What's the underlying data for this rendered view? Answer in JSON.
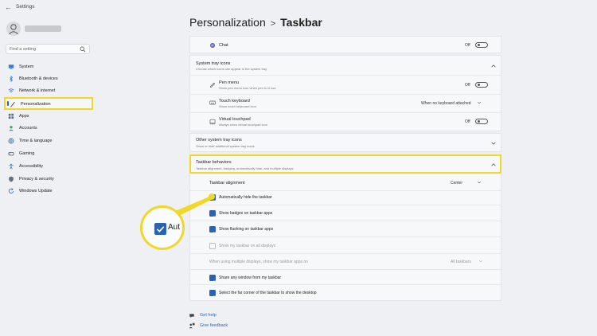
{
  "window": {
    "title": "Settings"
  },
  "sidebar": {
    "search_placeholder": "Find a setting",
    "items": [
      {
        "label": "System",
        "icon": "monitor-icon",
        "active": false
      },
      {
        "label": "Bluetooth & devices",
        "icon": "bluetooth-icon",
        "active": false
      },
      {
        "label": "Network & internet",
        "icon": "wifi-icon",
        "active": false
      },
      {
        "label": "Personalization",
        "icon": "brush-icon",
        "active": true
      },
      {
        "label": "Apps",
        "icon": "apps-icon",
        "active": false
      },
      {
        "label": "Accounts",
        "icon": "person-icon",
        "active": false
      },
      {
        "label": "Time & language",
        "icon": "globe-icon",
        "active": false
      },
      {
        "label": "Gaming",
        "icon": "gamepad-icon",
        "active": false
      },
      {
        "label": "Accessibility",
        "icon": "accessibility-icon",
        "active": false
      },
      {
        "label": "Privacy & security",
        "icon": "shield-icon",
        "active": false
      },
      {
        "label": "Windows Update",
        "icon": "update-icon",
        "active": false
      }
    ]
  },
  "breadcrumb": {
    "parent": "Personalization",
    "separator": ">",
    "current": "Taskbar"
  },
  "chat": {
    "label": "Chat",
    "state": "Off"
  },
  "system_tray": {
    "title": "System tray icons",
    "subtitle": "Choose which icons can appear in the system tray",
    "items": [
      {
        "title": "Pen menu",
        "subtitle": "Show pen menu icon when pen is in use",
        "control": "toggle",
        "state": "Off"
      },
      {
        "title": "Touch keyboard",
        "subtitle": "Show touch keyboard icon",
        "control": "dropdown",
        "value": "When no keyboard attached"
      },
      {
        "title": "Virtual touchpad",
        "subtitle": "Always show virtual touchpad icon",
        "control": "toggle",
        "state": "Off"
      }
    ]
  },
  "other_tray": {
    "title": "Other system tray icons",
    "subtitle": "Show or hide additional system tray icons"
  },
  "behaviors": {
    "title": "Taskbar behaviors",
    "subtitle": "Taskbar alignment, badging, automatically hide, and multiple displays",
    "alignment_label": "Taskbar alignment",
    "alignment_value": "Center",
    "checkboxes": [
      {
        "label": "Automatically hide the taskbar",
        "checked": true,
        "enabled": true
      },
      {
        "label": "Show badges on taskbar apps",
        "checked": true,
        "enabled": true
      },
      {
        "label": "Show flashing on taskbar apps",
        "checked": true,
        "enabled": true
      },
      {
        "label": "Show my taskbar on all displays",
        "checked": false,
        "enabled": false
      }
    ],
    "multi_display_label": "When using multiple displays, show my taskbar apps on",
    "multi_display_value": "All taskbars",
    "checkboxes2": [
      {
        "label": "Share any window from my taskbar",
        "checked": true
      },
      {
        "label": "Select the far corner of the taskbar to show the desktop",
        "checked": true
      }
    ]
  },
  "zoom": {
    "text": "Aut"
  },
  "footer": {
    "get_help": "Get help",
    "give_feedback": "Give feedback"
  },
  "colors": {
    "accent": "#2b63b3",
    "highlight": "#f2d62a"
  }
}
